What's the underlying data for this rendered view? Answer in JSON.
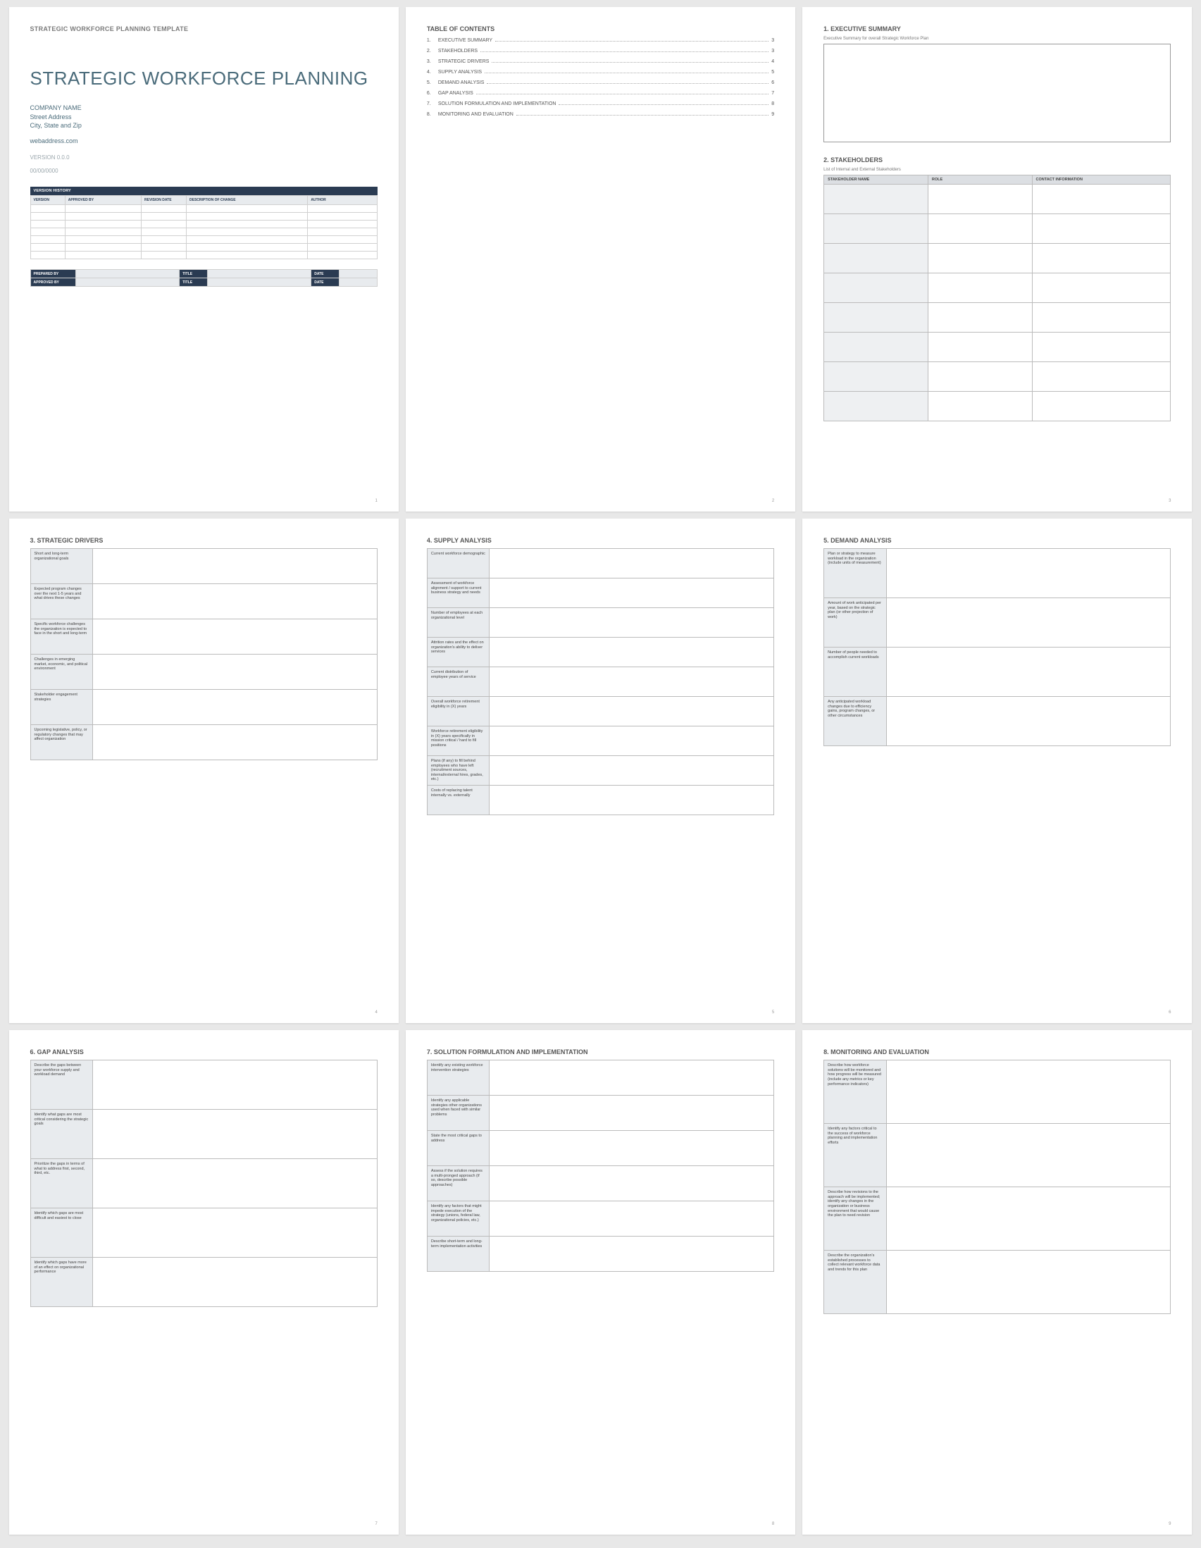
{
  "page1": {
    "header": "STRATEGIC WORKFORCE PLANNING TEMPLATE",
    "title": "STRATEGIC WORKFORCE PLANNING",
    "company": "COMPANY NAME",
    "street": "Street Address",
    "city": "City, State and Zip",
    "web": "webaddress.com",
    "version": "VERSION 0.0.0",
    "date": "00/00/0000",
    "vh_title": "VERSION HISTORY",
    "vh_cols": [
      "VERSION",
      "APPROVED BY",
      "REVISION DATE",
      "DESCRIPTION OF CHANGE",
      "AUTHOR"
    ],
    "sign": {
      "prepared": "PREPARED BY",
      "approved": "APPROVED BY",
      "title": "TITLE",
      "date": "DATE"
    }
  },
  "toc": {
    "title": "TABLE OF CONTENTS",
    "items": [
      {
        "num": "1.",
        "label": "EXECUTIVE SUMMARY",
        "pg": "3"
      },
      {
        "num": "2.",
        "label": "STAKEHOLDERS",
        "pg": "3"
      },
      {
        "num": "3.",
        "label": "STRATEGIC DRIVERS",
        "pg": "4"
      },
      {
        "num": "4.",
        "label": "SUPPLY ANALYSIS",
        "pg": "5"
      },
      {
        "num": "5.",
        "label": "DEMAND ANALYSIS",
        "pg": "6"
      },
      {
        "num": "6.",
        "label": "GAP ANALYSIS",
        "pg": "7"
      },
      {
        "num": "7.",
        "label": "SOLUTION FORMULATION AND IMPLEMENTATION",
        "pg": "8"
      },
      {
        "num": "8.",
        "label": "MONITORING AND EVALUATION",
        "pg": "9"
      }
    ]
  },
  "p3": {
    "h1": "1. EXECUTIVE SUMMARY",
    "note1": "Executive Summary for overall Strategic Workforce Plan",
    "h2": "2. STAKEHOLDERS",
    "note2": "List of Internal and External Stakeholders",
    "cols": [
      "STAKEHOLDER NAME",
      "ROLE",
      "CONTACT INFORMATION"
    ]
  },
  "p4": {
    "h": "3. STRATEGIC DRIVERS",
    "rows": [
      "Short and long-term organizational goals",
      "Expected program changes over the next 1-5 years and what drives these changes",
      "Specific workforce challenges the organization is expected to face in the short and long-term",
      "Challenges in emerging market, economic, and political environment",
      "Stakeholder engagement strategies",
      "Upcoming legislative, policy, or regulatory changes that may affect organization"
    ]
  },
  "p5": {
    "h": "4. SUPPLY ANALYSIS",
    "rows": [
      "Current workforce demographic",
      "Assessment of workforce alignment / support to current business strategy and needs",
      "Number of employees at each organizational level",
      "Attrition rates and the effect on organization's ability to deliver services",
      "Current distribution of employee years of service",
      "Overall workforce retirement eligibility in (X) years",
      "Workforce retirement eligibility in (X) years specifically in mission critical / hard to fill positions",
      "Plans (if any) to fill behind employees who have left (recruitment sources, internal/external hires, grades, etc.)",
      "Costs of replacing talent internally vs. externally"
    ]
  },
  "p6": {
    "h": "5. DEMAND ANALYSIS",
    "rows": [
      "Plan or strategy to measure workload in the organization (include units of measurement)",
      "Amount of work anticipated per year, based on the strategic plan (or other projection of work)",
      "Number of people needed to accomplish current workloads",
      "Any anticipated workload changes due to efficiency gains, program changes, or other circumstances"
    ]
  },
  "p7": {
    "h": "6. GAP ANALYSIS",
    "rows": [
      "Describe the gaps between your workforce supply and workload demand",
      "Identify what gaps are most critical considering the strategic goals",
      "Prioritize the gaps in terms of what to address first, second, third, etc.",
      "Identify which gaps are most difficult and easiest to close",
      "Identify which gaps have more of an effect on organizational performance"
    ]
  },
  "p8": {
    "h": "7. SOLUTION FORMULATION AND IMPLEMENTATION",
    "rows": [
      "Identify any existing workforce intervention strategies",
      "Identify any applicable strategies other organizations used when faced with similar problems",
      "State the most critical gaps to address",
      "Assess if the solution requires a multi-pronged approach (if so, describe possible approaches)",
      "Identify any factors that might impede execution of the strategy (unions, federal law, organizational policies, etc.)",
      "Describe short-term and long-term implementation activities"
    ]
  },
  "p9": {
    "h": "8. MONITORING AND EVALUATION",
    "rows": [
      "Describe how workforce solutions will be monitored and how progress will be measured (include any metrics or key performance indicators)",
      "Identify any factors critical to the success of workforce planning and implementation efforts",
      "Describe how revisions to the approach will be implemented; identify any changes in the organization or business environment that would cause the plan to need revision",
      "Describe the organization's established processes to collect relevant workforce data and trends for this plan"
    ]
  },
  "page_numbers": [
    "1",
    "2",
    "3",
    "4",
    "5",
    "6",
    "7",
    "8",
    "9"
  ]
}
